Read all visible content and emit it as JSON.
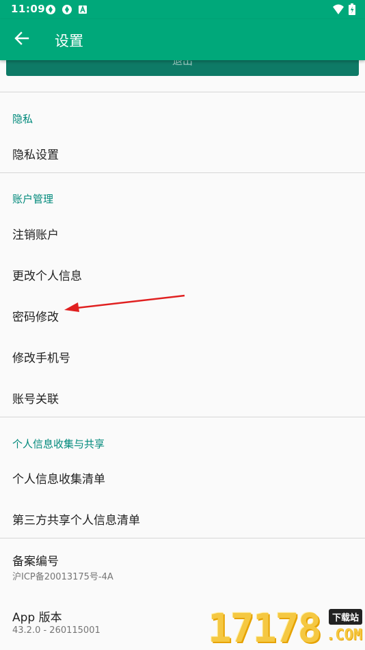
{
  "status_bar": {
    "time": "11:09",
    "icons": [
      "sync-icon",
      "sync-icon",
      "a-box-icon",
      "wifi-icon",
      "battery-icon"
    ]
  },
  "app_bar": {
    "back_icon": "arrow-left-icon",
    "title": "设置"
  },
  "top_button": {
    "label": "退出"
  },
  "sections": {
    "privacy": {
      "header": "隐私",
      "items": [
        "隐私设置"
      ]
    },
    "account": {
      "header": "账户管理",
      "items": [
        "注销账户",
        "更改个人信息",
        "密码修改",
        "修改手机号",
        "账号关联"
      ]
    },
    "info": {
      "header": "个人信息收集与共享",
      "items": [
        "个人信息收集清单",
        "第三方共享个人信息清单"
      ]
    },
    "filing": {
      "title": "备案编号",
      "value": "沪ICP备20013175号-4A"
    },
    "version": {
      "title": "App 版本",
      "value": "43.2.0 - 260115001"
    }
  },
  "watermark": {
    "digits": "17178",
    "badge": "下载站",
    "domain": ".COM"
  },
  "colors": {
    "primary": "#00a87a",
    "accent_text": "#00897b",
    "annotation_arrow": "#e02020"
  }
}
